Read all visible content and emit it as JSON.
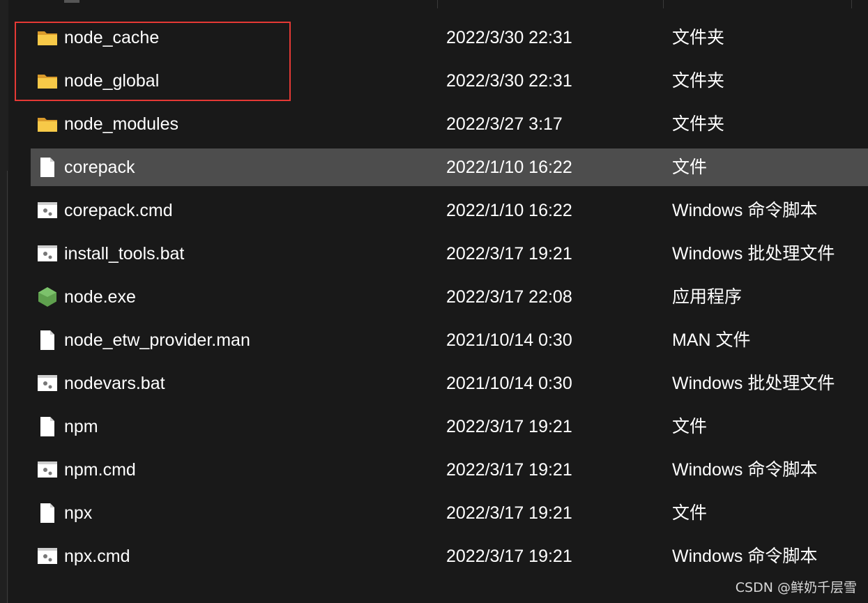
{
  "files": [
    {
      "name": "node_cache",
      "date": "2022/3/30 22:31",
      "type": "文件夹",
      "icon": "folder-icon"
    },
    {
      "name": "node_global",
      "date": "2022/3/30 22:31",
      "type": "文件夹",
      "icon": "folder-icon"
    },
    {
      "name": "node_modules",
      "date": "2022/3/27 3:17",
      "type": "文件夹",
      "icon": "folder-icon"
    },
    {
      "name": "corepack",
      "date": "2022/1/10 16:22",
      "type": "文件",
      "icon": "file-icon",
      "selected": true
    },
    {
      "name": "corepack.cmd",
      "date": "2022/1/10 16:22",
      "type": "Windows 命令脚本",
      "icon": "script-icon"
    },
    {
      "name": "install_tools.bat",
      "date": "2022/3/17 19:21",
      "type": "Windows 批处理文件",
      "icon": "script-icon"
    },
    {
      "name": "node.exe",
      "date": "2022/3/17 22:08",
      "type": "应用程序",
      "icon": "nodejs-icon"
    },
    {
      "name": "node_etw_provider.man",
      "date": "2021/10/14 0:30",
      "type": "MAN 文件",
      "icon": "file-icon"
    },
    {
      "name": "nodevars.bat",
      "date": "2021/10/14 0:30",
      "type": "Windows 批处理文件",
      "icon": "script-icon"
    },
    {
      "name": "npm",
      "date": "2022/3/17 19:21",
      "type": "文件",
      "icon": "file-icon"
    },
    {
      "name": "npm.cmd",
      "date": "2022/3/17 19:21",
      "type": "Windows 命令脚本",
      "icon": "script-icon"
    },
    {
      "name": "npx",
      "date": "2022/3/17 19:21",
      "type": "文件",
      "icon": "file-icon"
    },
    {
      "name": "npx.cmd",
      "date": "2022/3/17 19:21",
      "type": "Windows 命令脚本",
      "icon": "script-icon"
    }
  ],
  "watermark": "CSDN @鲜奶千层雪",
  "colors": {
    "background": "#191919",
    "selected_row": "#4d4d4d",
    "highlight_border": "#e53935",
    "folder": "#f5c242",
    "node_green": "#5fa04e"
  }
}
